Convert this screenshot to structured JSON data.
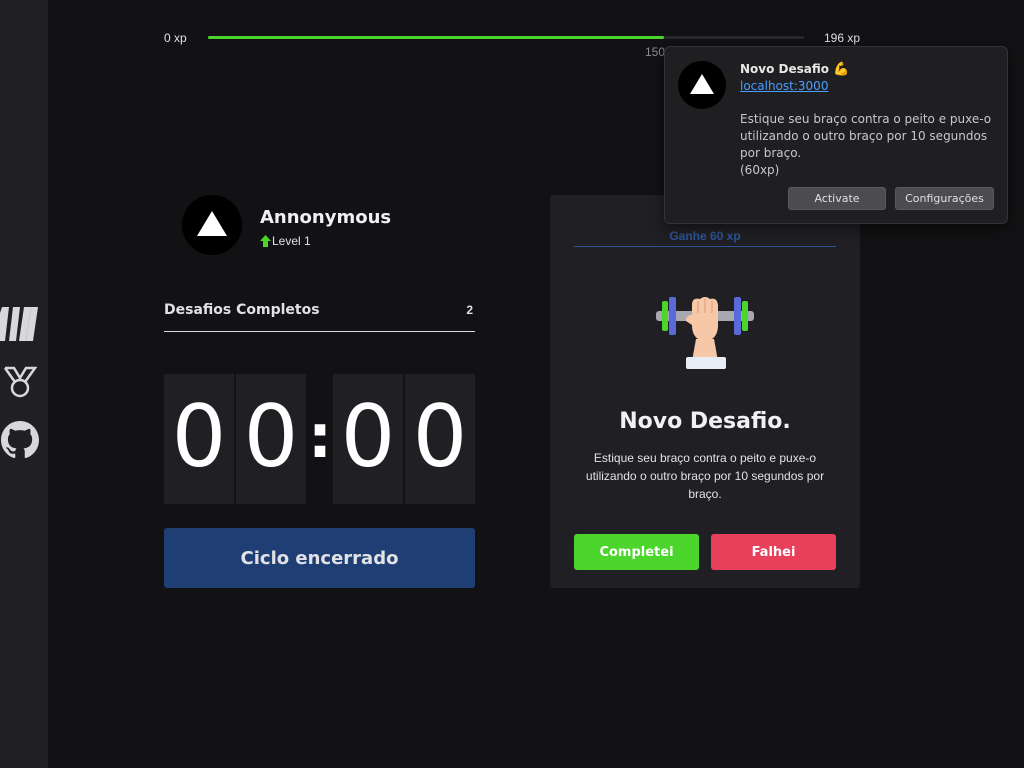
{
  "xp_bar": {
    "min_label": "0 xp",
    "max_label": "196 xp",
    "current_label": "150 xp",
    "progress_percent": 76.5,
    "fill_color": "#4cd62b"
  },
  "profile": {
    "name": "Annonymous",
    "level": "Level 1",
    "level_icon": "level-up-arrow-icon"
  },
  "completed": {
    "label": "Desafios Completos",
    "value": "2"
  },
  "countdown": {
    "minutes": [
      "0",
      "0"
    ],
    "seconds": [
      "0",
      "0"
    ],
    "separator": ":"
  },
  "cycle_button": {
    "label": "Ciclo encerrado",
    "color": "#1f3f74"
  },
  "challenge": {
    "header": "Ganhe 60 xp",
    "icon": "dumbbell-icon",
    "title": "Novo Desafio.",
    "description": "Estique seu braço contra o peito e puxe-o utilizando o outro braço por 10 segundos por braço.",
    "succeeded_label": "Completei",
    "failed_label": "Falhei",
    "succeeded_color": "#4cd62b",
    "failed_color": "#e83f5b"
  },
  "notification": {
    "title": "Novo Desafio",
    "title_emoji": "💪",
    "origin": "localhost:3000",
    "body": "Estique seu braço contra o peito e puxe-o utilizando o outro braço por 10 segundos por braço.",
    "xp_note": "(60xp)",
    "activate_label": "Activate",
    "settings_label": "Configurações"
  },
  "sidebar": {
    "items": [
      {
        "icon": "logo-icon"
      },
      {
        "icon": "medal-icon"
      },
      {
        "icon": "github-icon"
      }
    ]
  }
}
